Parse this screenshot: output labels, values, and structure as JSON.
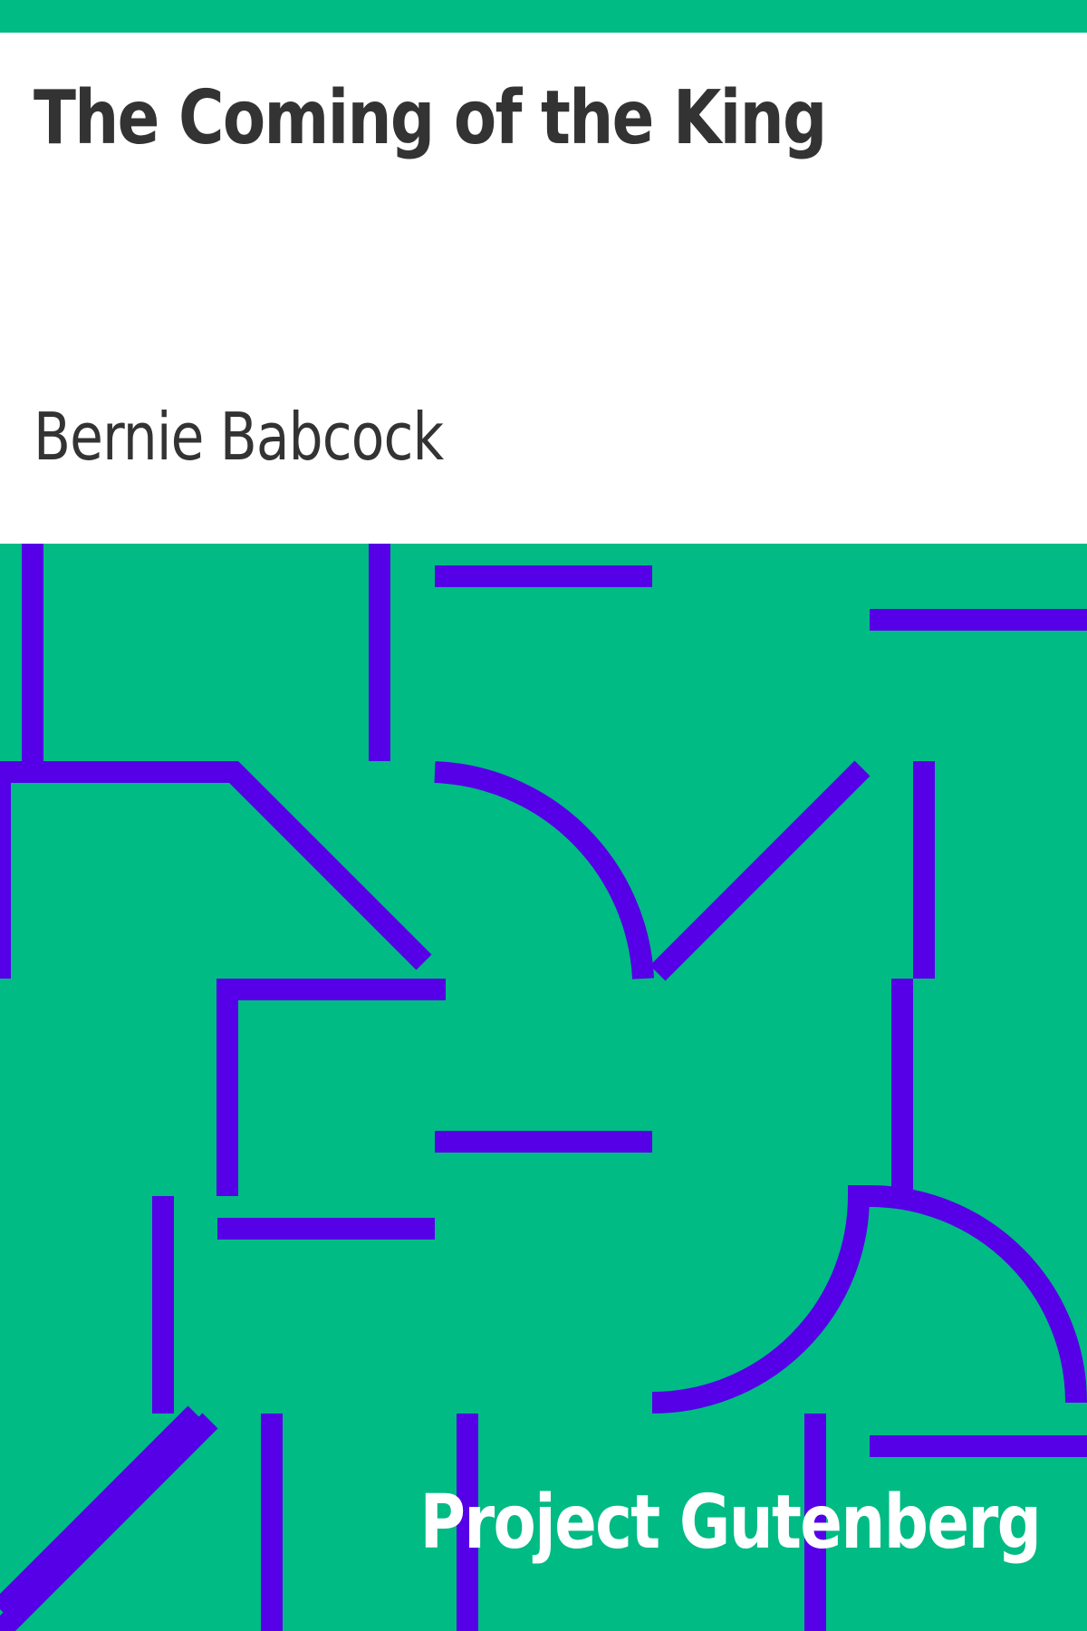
{
  "book": {
    "title": "The Coming of the King",
    "author": "Bernie Babcock"
  },
  "publisher": {
    "name": "Project Gutenberg"
  },
  "colors": {
    "accent": "#00bb84",
    "pattern_stroke": "#5500e6",
    "text_dark": "#333333",
    "text_light": "#ffffff",
    "background": "#ffffff"
  }
}
